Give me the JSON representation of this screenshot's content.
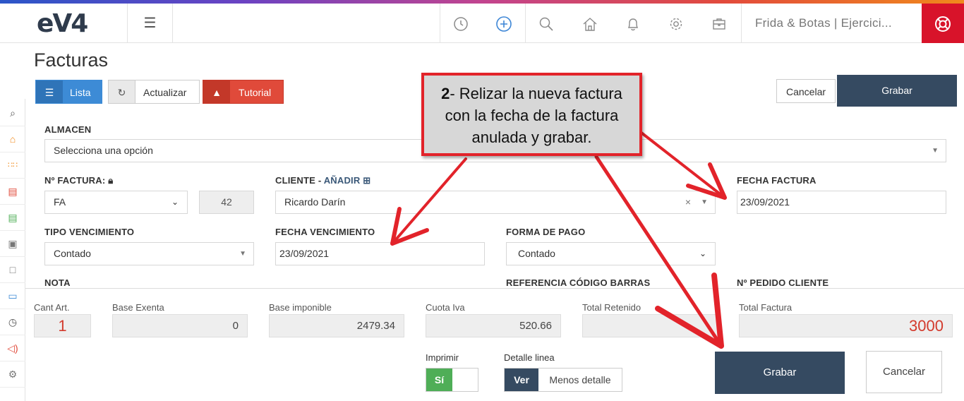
{
  "header": {
    "logo": "eV4",
    "company": "Frida & Botas | Ejercici...",
    "icons": [
      "history-icon",
      "plus-circle-icon",
      "search-icon",
      "home-icon",
      "bell-icon",
      "gear-icon",
      "briefcase-icon",
      "lifebuoy-icon"
    ]
  },
  "sidebar": {
    "icons": [
      "search-icon",
      "home-icon",
      "grid-icon",
      "invoice-red-icon",
      "invoice-green-icon",
      "contacts-icon",
      "book-icon",
      "card-icon",
      "timer-icon",
      "megaphone-icon",
      "gear-icon"
    ]
  },
  "page": {
    "title": "Facturas"
  },
  "toolbar": {
    "lista": "Lista",
    "actualizar": "Actualizar",
    "tutorial": "Tutorial",
    "cancelar": "Cancelar",
    "grabar": "Grabar"
  },
  "form": {
    "almacen_label": "ALMACEN",
    "almacen_value": "Selecciona una opción",
    "nfactura_label": "Nº FACTURA:",
    "serie_value": "FA",
    "numero_value": "42",
    "cliente_label": "CLIENTE -",
    "cliente_add": "AÑADIR",
    "cliente_value": "Ricardo Darín",
    "fecha_factura_label": "FECHA FACTURA",
    "fecha_factura_value": "23/09/2021",
    "tipo_venc_label": "TIPO VENCIMIENTO",
    "tipo_venc_value": "Contado",
    "fecha_venc_label": "FECHA VENCIMIENTO",
    "fecha_venc_value": "23/09/2021",
    "forma_pago_label": "FORMA DE PAGO",
    "forma_pago_value": "Contado",
    "nota_label": "NOTA",
    "ref_barras_label": "REFERENCIA CÓDIGO BARRAS",
    "pedido_label": "Nº PEDIDO CLIENTE"
  },
  "totals": {
    "cant_label": "Cant Art.",
    "cant_value": "1",
    "base_exenta_label": "Base Exenta",
    "base_exenta_value": "0",
    "base_imp_label": "Base imponible",
    "base_imp_value": "2479.34",
    "cuota_label": "Cuota Iva",
    "cuota_value": "520.66",
    "retenido_label": "Total Retenido",
    "retenido_value": "",
    "total_label": "Total Factura",
    "total_value": "3000",
    "imprimir_label": "Imprimir",
    "imprimir_on": "Sí",
    "detalle_label": "Detalle linea",
    "ver": "Ver",
    "menos_detalle": "Menos detalle",
    "grabar": "Grabar",
    "cancelar": "Cancelar"
  },
  "callout": {
    "step": "2",
    "text_line1": "- Relizar la nueva factura",
    "text_line2": "con la fecha de la factura",
    "text_line3": "anulada y grabar."
  },
  "colors": {
    "primary_dark": "#354a61",
    "blue": "#3d8bd6",
    "red": "#e04a3a",
    "green": "#4fae57",
    "arrow_red": "#e2232a"
  }
}
